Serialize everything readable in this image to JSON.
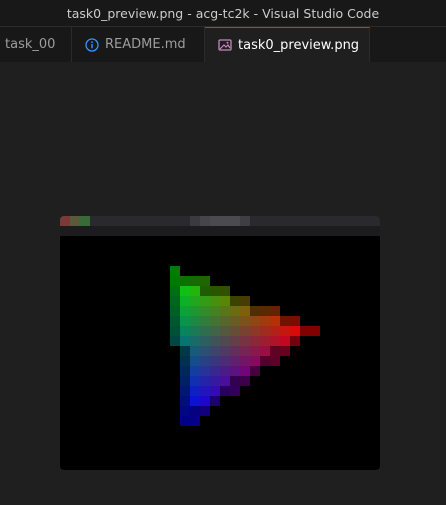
{
  "window": {
    "title": "task0_preview.png - acg-tc2k - Visual Studio Code"
  },
  "tabs": [
    {
      "label": "task_00",
      "icon": "none",
      "active": false
    },
    {
      "label": "README.md",
      "icon": "info-icon",
      "active": false
    },
    {
      "label": "task0_preview.png",
      "icon": "image-icon",
      "active": true,
      "close": "✕"
    }
  ],
  "colors": {
    "accent": "#0078d4",
    "background": "#1f1f1f",
    "titlebar": "#181818",
    "info_icon": "#3794ff",
    "image_icon": "#c586c0"
  }
}
